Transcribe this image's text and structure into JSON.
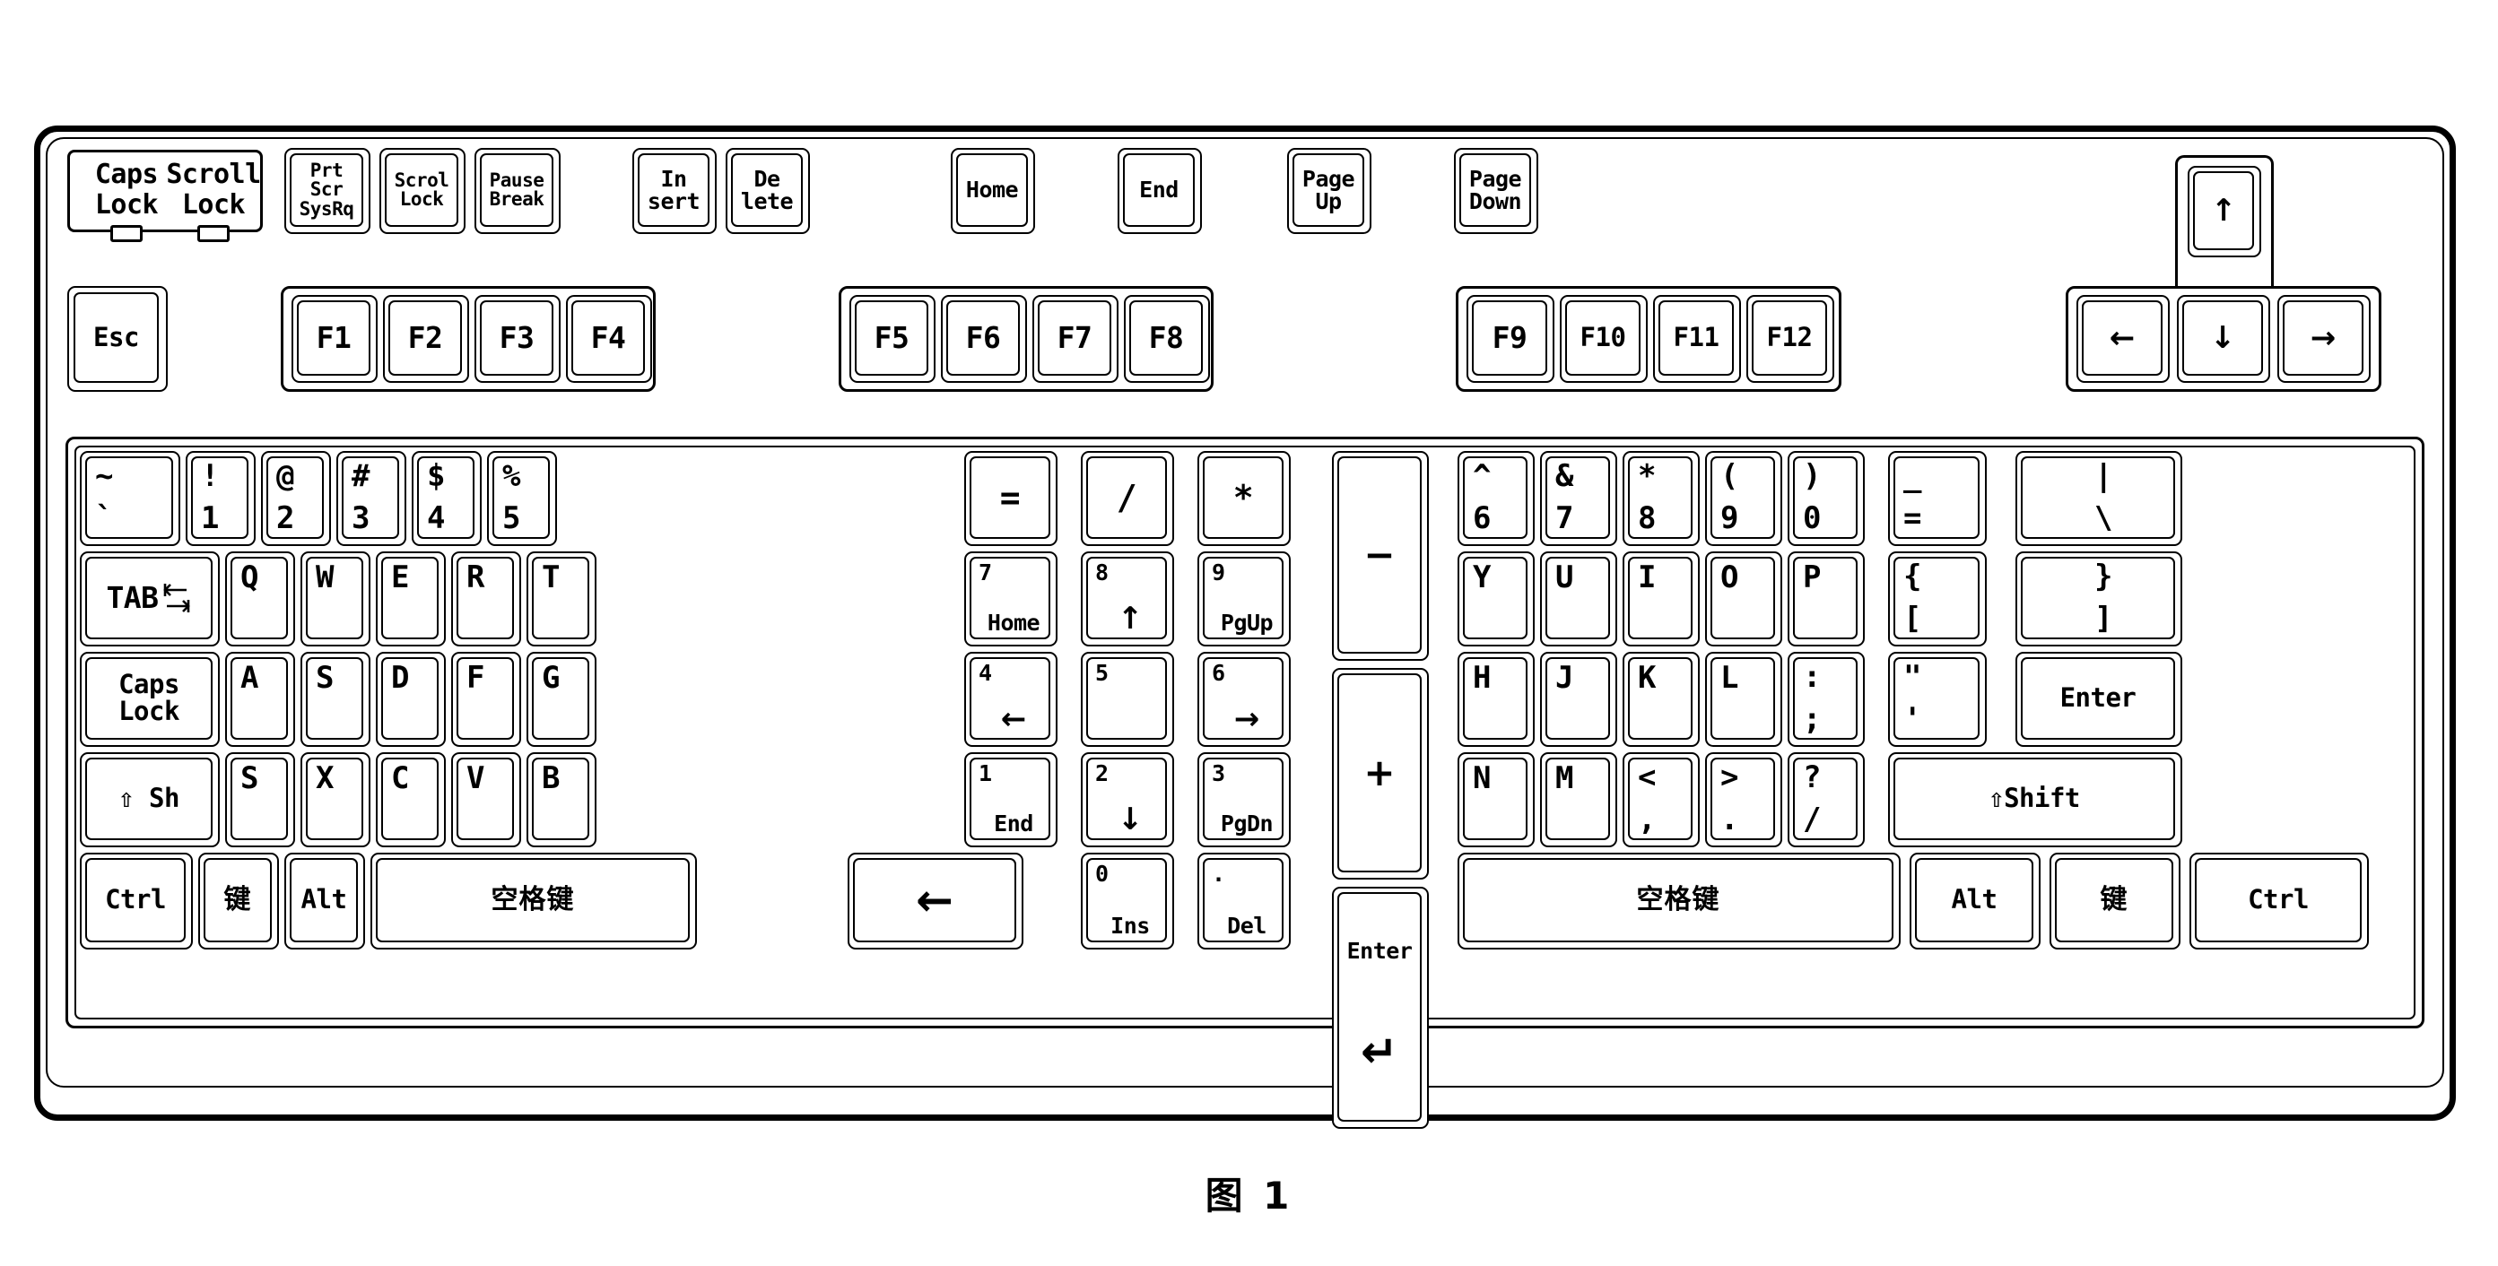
{
  "figure": {
    "caption": "图 1",
    "title": "Computer keyboard layout diagram"
  },
  "indicators": {
    "panel_name": "lock-indicator-panel",
    "items": [
      {
        "line1": "Caps",
        "line2": "Lock",
        "led": "off"
      },
      {
        "line1": "Scroll",
        "line2": "Lock",
        "led": "off"
      }
    ]
  },
  "top_row": {
    "system_keys": [
      {
        "name": "print-screen",
        "lines": [
          "Prt",
          "Scr",
          "SysRq"
        ]
      },
      {
        "name": "scroll-lock",
        "lines": [
          "Scrol",
          "Lock"
        ]
      },
      {
        "name": "pause-break",
        "lines": [
          "Pause",
          "Break"
        ]
      }
    ],
    "edit_keys": [
      {
        "name": "insert",
        "lines": [
          "In",
          "sert"
        ]
      },
      {
        "name": "delete",
        "lines": [
          "De",
          "lete"
        ]
      }
    ],
    "nav_keys": [
      {
        "name": "home",
        "lines": [
          "Home"
        ]
      },
      {
        "name": "end",
        "lines": [
          "End"
        ]
      },
      {
        "name": "page-up",
        "lines": [
          "Page",
          "Up"
        ]
      },
      {
        "name": "page-down",
        "lines": [
          "Page",
          "Down"
        ]
      }
    ],
    "arrow_up": {
      "name": "arrow-up",
      "glyph": "↑"
    }
  },
  "function_row": {
    "esc": "Esc",
    "group1": [
      "F1",
      "F2",
      "F3",
      "F4"
    ],
    "group2": [
      "F5",
      "F6",
      "F7",
      "F8"
    ],
    "group3": [
      "F9",
      "F10",
      "F11",
      "F12"
    ],
    "arrows": [
      {
        "name": "arrow-left",
        "glyph": "←"
      },
      {
        "name": "arrow-down",
        "glyph": "↓"
      },
      {
        "name": "arrow-right",
        "glyph": "→"
      }
    ]
  },
  "main_block": {
    "row_number_left": [
      {
        "name": "backquote",
        "top": "~",
        "bottom": "`"
      },
      {
        "name": "digit-1",
        "top": "!",
        "bottom": "1"
      },
      {
        "name": "digit-2",
        "top": "@",
        "bottom": "2"
      },
      {
        "name": "digit-3",
        "top": "#",
        "bottom": "3"
      },
      {
        "name": "digit-4",
        "top": "$",
        "bottom": "4"
      },
      {
        "name": "digit-5",
        "top": "%",
        "bottom": "5"
      }
    ],
    "row_number_right": [
      {
        "name": "digit-6",
        "top": "^",
        "bottom": "6"
      },
      {
        "name": "digit-7",
        "top": "&",
        "bottom": "7"
      },
      {
        "name": "digit-8",
        "top": "*",
        "bottom": "8"
      },
      {
        "name": "digit-9",
        "top": "(",
        "bottom": "9"
      },
      {
        "name": "digit-0",
        "top": ")",
        "bottom": "0"
      },
      {
        "name": "minus",
        "top": "_",
        "bottom": "="
      },
      {
        "name": "backslash",
        "top": "|",
        "bottom": "\\"
      }
    ],
    "row_q_left": {
      "tab": "TAB",
      "letters": [
        "Q",
        "W",
        "E",
        "R",
        "T"
      ]
    },
    "row_q_right": {
      "letters": [
        "Y",
        "U",
        "I",
        "O",
        "P"
      ],
      "brackets": [
        {
          "name": "bracket-left",
          "top": "{",
          "bottom": "["
        },
        {
          "name": "bracket-right",
          "top": "}",
          "bottom": "]"
        }
      ]
    },
    "row_a_left": {
      "caps_lock": [
        "Caps",
        "Lock"
      ],
      "letters": [
        "A",
        "S",
        "D",
        "F",
        "G"
      ]
    },
    "row_a_right": {
      "letters": [
        "H",
        "J",
        "K",
        "L"
      ],
      "semicolon": {
        "name": "semicolon",
        "top": ":",
        "bottom": ";"
      },
      "quote": {
        "name": "quote",
        "top": "\"",
        "bottom": "'"
      },
      "enter": "Enter"
    },
    "row_z_left": {
      "shift": "⇧ Sh",
      "letters": [
        "S",
        "X",
        "C",
        "V",
        "B"
      ]
    },
    "row_z_right": {
      "letters": [
        "N",
        "M"
      ],
      "punct": [
        {
          "name": "comma",
          "top": "<",
          "bottom": ","
        },
        {
          "name": "period",
          "top": ">",
          "bottom": "."
        },
        {
          "name": "slash",
          "top": "?",
          "bottom": "/"
        }
      ],
      "shift": "⇧Shift"
    },
    "bottom_left": {
      "ctrl": "Ctrl",
      "win": "键",
      "alt": "Alt",
      "space": "空格键",
      "backspace_glyph": "←"
    },
    "bottom_right": {
      "space": "空格键",
      "alt": "Alt",
      "win": "键",
      "ctrl": "Ctrl"
    },
    "numpad": {
      "row1": [
        {
          "name": "numpad-equals",
          "label": "="
        },
        {
          "name": "numpad-divide",
          "label": "/"
        },
        {
          "name": "numpad-multiply",
          "label": "*"
        }
      ],
      "row2": [
        {
          "name": "numpad-7",
          "digit": "7",
          "sub": "Home"
        },
        {
          "name": "numpad-8",
          "digit": "8",
          "sub": "↑"
        },
        {
          "name": "numpad-9",
          "digit": "9",
          "sub": "PgUp"
        }
      ],
      "row3": [
        {
          "name": "numpad-4",
          "digit": "4",
          "sub": "←"
        },
        {
          "name": "numpad-5",
          "digit": "5",
          "sub": ""
        },
        {
          "name": "numpad-6",
          "digit": "6",
          "sub": "→"
        }
      ],
      "row4": [
        {
          "name": "numpad-1",
          "digit": "1",
          "sub": "End"
        },
        {
          "name": "numpad-2",
          "digit": "2",
          "sub": "↓"
        },
        {
          "name": "numpad-3",
          "digit": "3",
          "sub": "PgDn"
        }
      ],
      "row5": [
        {
          "name": "numpad-0",
          "digit": "0",
          "sub": "Ins"
        },
        {
          "name": "numpad-decimal",
          "digit": ".",
          "sub": "Del"
        }
      ],
      "minus": "−",
      "plus": "+",
      "enter_label": "Enter",
      "enter_glyph": "↵"
    }
  }
}
